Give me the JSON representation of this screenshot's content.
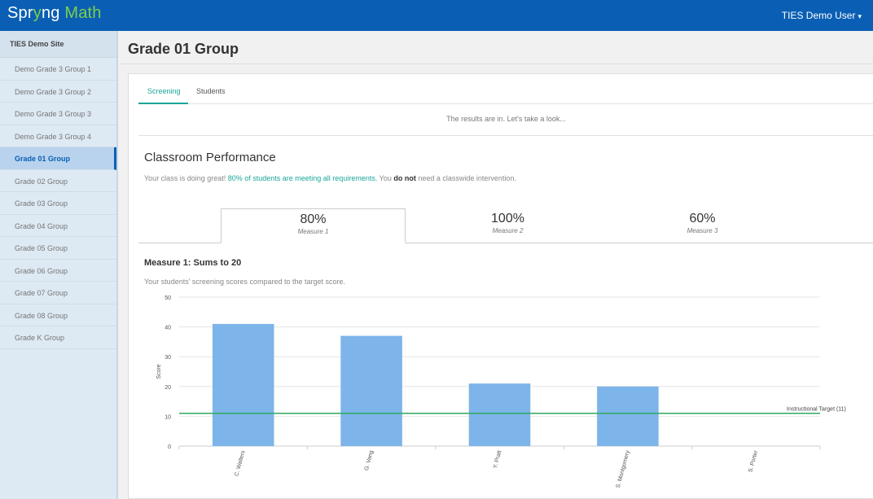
{
  "app": {
    "logo_prefix": "Spr",
    "logo_glyph": "y",
    "logo_suffix": "ng",
    "logo_rest": " Math",
    "user_menu": "TIES Demo User",
    "brand_color": "#0a5fb4"
  },
  "sidebar": {
    "site_title": "TIES Demo Site",
    "items": [
      {
        "label": "Demo Grade 3 Group 1"
      },
      {
        "label": "Demo Grade 3 Group 2"
      },
      {
        "label": "Demo Grade 3 Group 3"
      },
      {
        "label": "Demo Grade 3 Group 4"
      },
      {
        "label": "Grade 01 Group"
      },
      {
        "label": "Grade 02 Group"
      },
      {
        "label": "Grade 03 Group"
      },
      {
        "label": "Grade 04 Group"
      },
      {
        "label": "Grade 05 Group"
      },
      {
        "label": "Grade 06 Group"
      },
      {
        "label": "Grade 07 Group"
      },
      {
        "label": "Grade 08 Group"
      },
      {
        "label": "Grade K Group"
      }
    ],
    "active_item": "Grade 01 Group"
  },
  "main": {
    "page_title": "Grade 01 Group",
    "tabs": [
      {
        "label": "Screening"
      },
      {
        "label": "Students"
      }
    ],
    "active_tab": "Screening",
    "results_text": "The results are in. Let's take a look...",
    "performance": {
      "title": "Classroom Performance",
      "msg_start": "Your class is doing great! ",
      "msg_highlight": "80% of students are meeting all requirements.",
      "msg_mid": " You ",
      "msg_bold": "do not",
      "msg_end": " need a classwide intervention."
    },
    "measure_tabs": [
      {
        "percent": "80%",
        "label": "Measure 1"
      },
      {
        "percent": "100%",
        "label": "Measure 2"
      },
      {
        "percent": "60%",
        "label": "Measure 3"
      }
    ],
    "active_measure": "Measure 1",
    "measure_title": "Measure 1: Sums to 20",
    "measure_desc": "Your students' screening scores compared to the target score."
  },
  "colors": {
    "accent_teal": "#1aa69a",
    "bar": "#7db4e9",
    "target_line": "#2eaa5f"
  },
  "chart_data": {
    "type": "bar",
    "categories": [
      "C. Walters",
      "G. Vang",
      "Y. Pratt",
      "S. Montgomery",
      "S. Porter"
    ],
    "values": [
      41,
      37,
      21,
      20,
      0
    ],
    "ylabel": "Score",
    "xlabel": "",
    "ylim": [
      0,
      50
    ],
    "yticks": [
      0,
      10,
      20,
      30,
      40,
      50
    ],
    "grid": true,
    "reference_line": {
      "value": 11,
      "label": "Instructional Target (11)"
    }
  }
}
